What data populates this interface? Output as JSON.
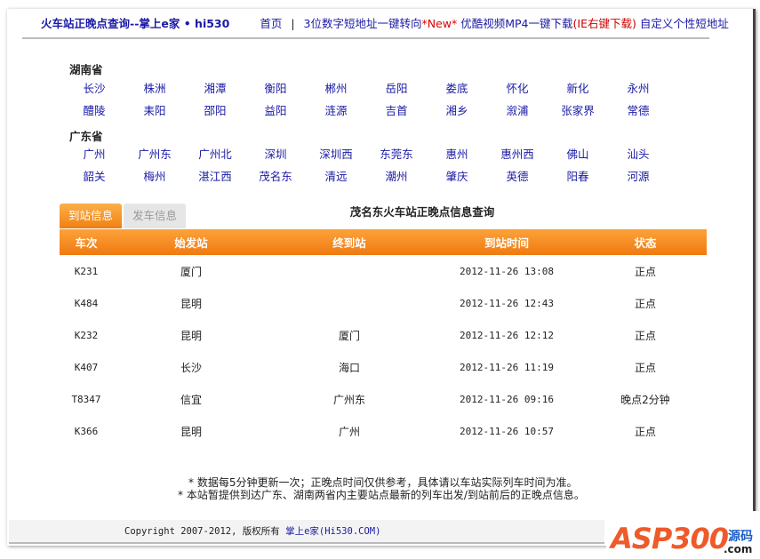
{
  "header": {
    "brand": "火车站正晚点查询--掌上e家 • hi530",
    "nav": {
      "home": "首页",
      "sep": "|",
      "short_url": "3位数字短地址一键转向",
      "new": "*New*",
      "youku": "优酷视频MP4一键下载",
      "ie": "(IE右键下载)",
      "custom": "自定义个性短地址"
    }
  },
  "provinces": [
    {
      "name": "湖南省",
      "rows": [
        [
          "长沙",
          "株洲",
          "湘潭",
          "衡阳",
          "郴州",
          "岳阳",
          "娄底",
          "怀化",
          "新化",
          "永州"
        ],
        [
          "醴陵",
          "耒阳",
          "邵阳",
          "益阳",
          "涟源",
          "吉首",
          "湘乡",
          "溆浦",
          "张家界",
          "常德"
        ]
      ]
    },
    {
      "name": "广东省",
      "rows": [
        [
          "广州",
          "广州东",
          "广州北",
          "深圳",
          "深圳西",
          "东莞东",
          "惠州",
          "惠州西",
          "佛山",
          "汕头"
        ],
        [
          "韶关",
          "梅州",
          "湛江西",
          "茂名东",
          "清远",
          "潮州",
          "肇庆",
          "英德",
          "阳春",
          "河源"
        ]
      ]
    }
  ],
  "tabs": [
    "到站信息",
    "发车信息"
  ],
  "title": "茂名东火车站正晚点信息查询",
  "table": {
    "headers": [
      "车次",
      "始发站",
      "终到站",
      "到站时间",
      "状态"
    ],
    "rows": [
      [
        "K231",
        "厦门",
        "",
        "2012-11-26 13:08",
        "正点"
      ],
      [
        "K484",
        "昆明",
        "",
        "2012-11-26 12:43",
        "正点"
      ],
      [
        "K232",
        "昆明",
        "厦门",
        "2012-11-26 12:12",
        "正点"
      ],
      [
        "K407",
        "长沙",
        "海口",
        "2012-11-26 11:19",
        "正点"
      ],
      [
        "T8347",
        "信宜",
        "广州东",
        "2012-11-26 09:16",
        "晚点2分钟"
      ],
      [
        "K366",
        "昆明",
        "广州",
        "2012-11-26 10:57",
        "正点"
      ]
    ]
  },
  "notes": [
    "* 数据每5分钟更新一次；正晚点时间仅供参考，具体请以车站实际列车时间为准。",
    "* 本站暂提供到达广东、湖南两省内主要站点最新的列车出发/到站前后的正晚点信息。"
  ],
  "footer": {
    "text": "Copyright 2007-2012, 版权所有 ",
    "link": "掌上e家(Hi530.COM)"
  },
  "logo": {
    "text": "ASP300",
    "sub": "源码",
    ".com": ".com"
  }
}
